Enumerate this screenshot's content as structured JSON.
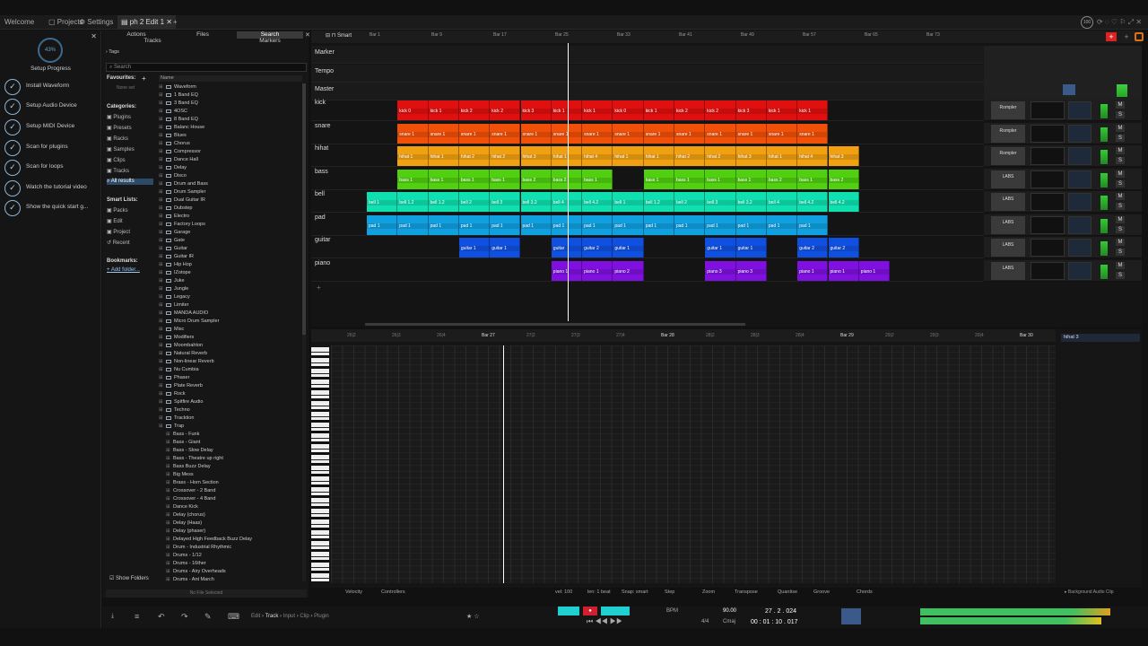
{
  "tabs": [
    "Welcome",
    "Projects",
    "Settings",
    "ph 2 Edit 1"
  ],
  "setup": {
    "progress": "43%",
    "title": "Setup Progress",
    "steps": [
      "Install Waveform",
      "Setup Audio Device",
      "Setup MIDI Device",
      "Scan for plugins",
      "Scan for loops",
      "Watch the tutorial video",
      "Show the quick start g..."
    ]
  },
  "browser": {
    "tabs": [
      "Actions",
      "Files",
      "Search",
      "Tracks",
      "Markers"
    ],
    "tags": "Tags",
    "search_placeholder": "Search",
    "favourites": "Favourites:",
    "none_set": "None set",
    "name_col": "Name",
    "categories_label": "Categories:",
    "categories": [
      "Plugins",
      "Presets",
      "Racks",
      "Samples",
      "Clips",
      "Tracks",
      "All results"
    ],
    "smart_label": "Smart Lists:",
    "smart": [
      "Packs",
      "Edit",
      "Project",
      "Recent"
    ],
    "bookmarks_label": "Bookmarks:",
    "add_folder": "Add folder...",
    "show_folders": "Show Folders",
    "no_file": "No File Selected",
    "folders": [
      "Waveform",
      "1 Band EQ",
      "3 Band EQ",
      "4OSC",
      "8 Band EQ",
      "Balanc House",
      "Blues",
      "Chorus",
      "Compressor",
      "Dance Hall",
      "Delay",
      "Disco",
      "Drum and Bass",
      "Drum Sampler",
      "Dual Guitar IR",
      "Dubstep",
      "Electro",
      "Factory Loops",
      "Garage",
      "Gate",
      "Guitar",
      "Guitar IR",
      "Hip Hop",
      "IZotope",
      "Juke",
      "Jungle",
      "Legacy",
      "Limiter",
      "MANDA AUDIO",
      "Micro Drum Sampler",
      "Misc",
      "Modifiers",
      "Moombahton",
      "Natural Reverb",
      "Non-linear Reverb",
      "Nu Cumbia",
      "Phaser",
      "Plate Reverb",
      "Rock",
      "Spitfire Audio",
      "Techno",
      "Tracktion",
      "Trap"
    ],
    "presets": [
      "Bass - Funk",
      "Bass - Giant",
      "Bass - Slow Delay",
      "Bass - Theatre up right",
      "Bass Buzz Delay",
      "Big Mess",
      "Brass - Horn Section",
      "Crossover - 2 Band",
      "Crossover - 4 Band",
      "Dance Kick",
      "Delay (chorus)",
      "Delay (Haas)",
      "Delay (phaser)",
      "Delayed High Feedback Buzz Delay",
      "Drum - Industrial Rhythmic",
      "Drums - 1/12",
      "Drums - 16ther",
      "Drums - Airy Overheads",
      "Drums - Ant March"
    ]
  },
  "timeline": {
    "bars": [
      "Bar 1",
      "Bar 9",
      "Bar 17",
      "Bar 25",
      "Bar 33",
      "Bar 41",
      "Bar 49",
      "Bar 57",
      "Bar 65",
      "Bar 73"
    ],
    "special": [
      "Marker",
      "Tempo",
      "Master"
    ],
    "smart": "Smart"
  },
  "tracks": [
    {
      "name": "kick",
      "color": "#e01010",
      "clips": [
        {
          "s": 1,
          "e": 2,
          "l": "kick 0"
        },
        {
          "s": 2,
          "e": 3,
          "l": "kick 1"
        },
        {
          "s": 3,
          "e": 4,
          "l": "kick 2"
        },
        {
          "s": 4,
          "e": 5,
          "l": "kick 2"
        },
        {
          "s": 5,
          "e": 6,
          "l": "kick 3"
        },
        {
          "s": 6,
          "e": 7,
          "l": "kick 1"
        },
        {
          "s": 7,
          "e": 8,
          "l": "kick 1"
        },
        {
          "s": 8,
          "e": 9,
          "l": "kick 0"
        },
        {
          "s": 9,
          "e": 10,
          "l": "kick 1"
        },
        {
          "s": 10,
          "e": 11,
          "l": "kick 2"
        },
        {
          "s": 11,
          "e": 12,
          "l": "kick 2"
        },
        {
          "s": 12,
          "e": 13,
          "l": "kick 3"
        },
        {
          "s": 13,
          "e": 14,
          "l": "kick 1"
        },
        {
          "s": 14,
          "e": 15,
          "l": "kick 1"
        }
      ]
    },
    {
      "name": "snare",
      "color": "#f05008",
      "clips": [
        {
          "s": 1,
          "e": 2,
          "l": "snare 1"
        },
        {
          "s": 2,
          "e": 3,
          "l": "snare 1"
        },
        {
          "s": 3,
          "e": 4,
          "l": "snare 1"
        },
        {
          "s": 4,
          "e": 5,
          "l": "snare 1"
        },
        {
          "s": 5,
          "e": 6,
          "l": "snare 1"
        },
        {
          "s": 6,
          "e": 7,
          "l": "snare 1"
        },
        {
          "s": 7,
          "e": 8,
          "l": "snare 1"
        },
        {
          "s": 8,
          "e": 9,
          "l": "snare 1"
        },
        {
          "s": 9,
          "e": 10,
          "l": "snare 1"
        },
        {
          "s": 10,
          "e": 11,
          "l": "snare 1"
        },
        {
          "s": 11,
          "e": 12,
          "l": "snare 1"
        },
        {
          "s": 12,
          "e": 13,
          "l": "snare 1"
        },
        {
          "s": 13,
          "e": 14,
          "l": "snare 1"
        },
        {
          "s": 14,
          "e": 15,
          "l": "snare 1"
        }
      ]
    },
    {
      "name": "hihat",
      "color": "#f0a010",
      "clips": [
        {
          "s": 1,
          "e": 2,
          "l": "hihat 1"
        },
        {
          "s": 2,
          "e": 3,
          "l": "hihat 1"
        },
        {
          "s": 3,
          "e": 4,
          "l": "hihat 2"
        },
        {
          "s": 4,
          "e": 5,
          "l": "hihat 2"
        },
        {
          "s": 5,
          "e": 6,
          "l": "hihat 3"
        },
        {
          "s": 6,
          "e": 7,
          "l": "hihat 1"
        },
        {
          "s": 7,
          "e": 8,
          "l": "hihat 4"
        },
        {
          "s": 8,
          "e": 9,
          "l": "hihat 1"
        },
        {
          "s": 9,
          "e": 10,
          "l": "hihat 1"
        },
        {
          "s": 10,
          "e": 11,
          "l": "hihat 2"
        },
        {
          "s": 11,
          "e": 12,
          "l": "hihat 2"
        },
        {
          "s": 12,
          "e": 13,
          "l": "hihat 3"
        },
        {
          "s": 13,
          "e": 14,
          "l": "hihat 1"
        },
        {
          "s": 14,
          "e": 15,
          "l": "hihat 4"
        },
        {
          "s": 15,
          "e": 16,
          "l": "hihat 3"
        }
      ]
    },
    {
      "name": "bass",
      "color": "#50d010",
      "clips": [
        {
          "s": 1,
          "e": 2,
          "l": "bass 1"
        },
        {
          "s": 2,
          "e": 3,
          "l": "bass 1"
        },
        {
          "s": 3,
          "e": 4,
          "l": "bass 1"
        },
        {
          "s": 4,
          "e": 5,
          "l": "bass 1"
        },
        {
          "s": 5,
          "e": 6,
          "l": "bass 2"
        },
        {
          "s": 6,
          "e": 7,
          "l": "bass 2"
        },
        {
          "s": 7,
          "e": 8,
          "l": "bass 1"
        },
        {
          "s": 9,
          "e": 10,
          "l": "bass 1"
        },
        {
          "s": 10,
          "e": 11,
          "l": "bass 1"
        },
        {
          "s": 11,
          "e": 12,
          "l": "bass 1"
        },
        {
          "s": 12,
          "e": 13,
          "l": "bass 1"
        },
        {
          "s": 13,
          "e": 14,
          "l": "bass 2"
        },
        {
          "s": 14,
          "e": 15,
          "l": "bass 1"
        },
        {
          "s": 15,
          "e": 16,
          "l": "bass 2"
        }
      ]
    },
    {
      "name": "bell",
      "color": "#10e0b0",
      "clips": [
        {
          "s": 0,
          "e": 1,
          "l": "bell 1"
        },
        {
          "s": 1,
          "e": 2,
          "l": "bell 1.2"
        },
        {
          "s": 2,
          "e": 3,
          "l": "bell 1.2"
        },
        {
          "s": 3,
          "e": 4,
          "l": "bell 2"
        },
        {
          "s": 4,
          "e": 5,
          "l": "bell 3"
        },
        {
          "s": 5,
          "e": 6,
          "l": "bell 3.2"
        },
        {
          "s": 6,
          "e": 7,
          "l": "bell 4"
        },
        {
          "s": 7,
          "e": 8,
          "l": "bell 4.2"
        },
        {
          "s": 8,
          "e": 9,
          "l": "bell 1"
        },
        {
          "s": 9,
          "e": 10,
          "l": "bell 1.2"
        },
        {
          "s": 10,
          "e": 11,
          "l": "bell 2"
        },
        {
          "s": 11,
          "e": 12,
          "l": "bell 3"
        },
        {
          "s": 12,
          "e": 13,
          "l": "bell 3.2"
        },
        {
          "s": 13,
          "e": 14,
          "l": "bell 4"
        },
        {
          "s": 14,
          "e": 15,
          "l": "bell 4.2"
        },
        {
          "s": 15,
          "e": 16,
          "l": "bell 4.2"
        }
      ]
    },
    {
      "name": "pad",
      "color": "#10a0e0",
      "clips": [
        {
          "s": 0,
          "e": 1,
          "l": "pad 1"
        },
        {
          "s": 1,
          "e": 2,
          "l": "pad 1"
        },
        {
          "s": 2,
          "e": 3,
          "l": "pad 1"
        },
        {
          "s": 3,
          "e": 4,
          "l": "pad 1"
        },
        {
          "s": 4,
          "e": 5,
          "l": "pad 1"
        },
        {
          "s": 5,
          "e": 6,
          "l": "pad 1"
        },
        {
          "s": 6,
          "e": 7,
          "l": "pad 1"
        },
        {
          "s": 7,
          "e": 8,
          "l": "pad 1"
        },
        {
          "s": 8,
          "e": 9,
          "l": "pad 1"
        },
        {
          "s": 9,
          "e": 10,
          "l": "pad 1"
        },
        {
          "s": 10,
          "e": 11,
          "l": "pad 1"
        },
        {
          "s": 11,
          "e": 12,
          "l": "pad 1"
        },
        {
          "s": 12,
          "e": 13,
          "l": "pad 1"
        },
        {
          "s": 13,
          "e": 14,
          "l": "pad 1"
        },
        {
          "s": 14,
          "e": 15,
          "l": "pad 1"
        }
      ]
    },
    {
      "name": "guitar",
      "color": "#1050e0",
      "clips": [
        {
          "s": 3,
          "e": 4,
          "l": "guitar 1"
        },
        {
          "s": 4,
          "e": 5,
          "l": "guitar 1"
        },
        {
          "s": 6,
          "e": 7,
          "l": "guitar"
        },
        {
          "s": 7,
          "e": 8,
          "l": "guitar 2"
        },
        {
          "s": 8,
          "e": 9,
          "l": "guitar 1"
        },
        {
          "s": 11,
          "e": 12,
          "l": "guitar 1"
        },
        {
          "s": 12,
          "e": 13,
          "l": "guitar 1"
        },
        {
          "s": 14,
          "e": 15,
          "l": "guitar 2"
        },
        {
          "s": 15,
          "e": 16,
          "l": "guitar 2"
        }
      ]
    },
    {
      "name": "piano",
      "color": "#8010e0",
      "clips": [
        {
          "s": 6,
          "e": 7,
          "l": "piano 1"
        },
        {
          "s": 7,
          "e": 8,
          "l": "piano 1"
        },
        {
          "s": 8,
          "e": 9,
          "l": "piano 2"
        },
        {
          "s": 11,
          "e": 12,
          "l": "piano 3"
        },
        {
          "s": 12,
          "e": 13,
          "l": "piano 3"
        },
        {
          "s": 14,
          "e": 15,
          "l": "piano 1"
        },
        {
          "s": 15,
          "e": 16,
          "l": "piano 1"
        },
        {
          "s": 16,
          "e": 17,
          "l": "piano 1"
        }
      ]
    }
  ],
  "track_ctrl": {
    "plugins": [
      "Rompler",
      "Rompler",
      "Rompler",
      "LABS",
      "LABS",
      "LABS",
      "LABS",
      "LABS"
    ],
    "m": "M",
    "s": "S"
  },
  "pianoroll": {
    "bars": [
      "26|2",
      "26|3",
      "26|4",
      "Bar 27",
      "27|2",
      "27|3",
      "27|4",
      "Bar 28",
      "28|2",
      "28|3",
      "28|4",
      "Bar 29",
      "29|2",
      "29|3",
      "29|4",
      "Bar 30"
    ],
    "clip_name": "hihat 3",
    "bg_clip": "Background Audio Clip",
    "toolbar": [
      "Velocity",
      "Controllers",
      "vel: 100",
      "len: 1 beat",
      "Snap: smart",
      "Step",
      "Zoom",
      "Transpose",
      "Quantise",
      "Groove",
      "Chords"
    ]
  },
  "transport": {
    "crumbs": [
      "Edit",
      "Track",
      "Input",
      "Clip",
      "Plugin"
    ],
    "bpm_label": "BPM",
    "bpm": "90.00",
    "sig": "4/4",
    "key": "Cmaj",
    "pos_bars": "27 . 2 . 024",
    "pos_time": "00 : 01 : 10 . 017"
  },
  "colors": {
    "accent": "#3d6a8a",
    "record": "#e02020",
    "play": "#20d0d0"
  }
}
